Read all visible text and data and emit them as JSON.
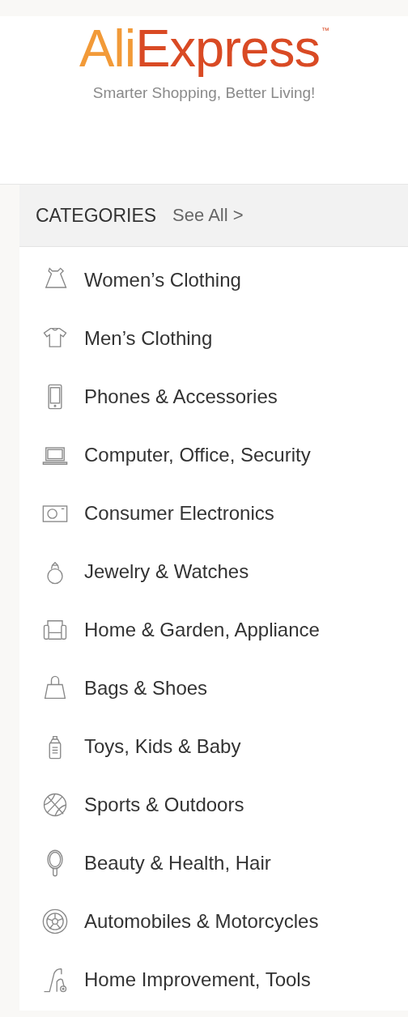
{
  "logo": {
    "first": "Ali",
    "second": "Express",
    "mark": "™"
  },
  "tagline": "Smarter Shopping, Better Living!",
  "categories": {
    "title": "CATEGORIES",
    "see_all": "See All >",
    "items": [
      {
        "label": "Women’s Clothing"
      },
      {
        "label": "Men’s Clothing"
      },
      {
        "label": "Phones & Accessories"
      },
      {
        "label": "Computer, Office, Security"
      },
      {
        "label": "Consumer Electronics"
      },
      {
        "label": "Jewelry & Watches"
      },
      {
        "label": "Home & Garden, Appliance"
      },
      {
        "label": "Bags & Shoes"
      },
      {
        "label": "Toys, Kids & Baby"
      },
      {
        "label": "Sports & Outdoors"
      },
      {
        "label": "Beauty & Health, Hair"
      },
      {
        "label": "Automobiles & Motorcycles"
      },
      {
        "label": "Home Improvement, Tools"
      }
    ]
  }
}
